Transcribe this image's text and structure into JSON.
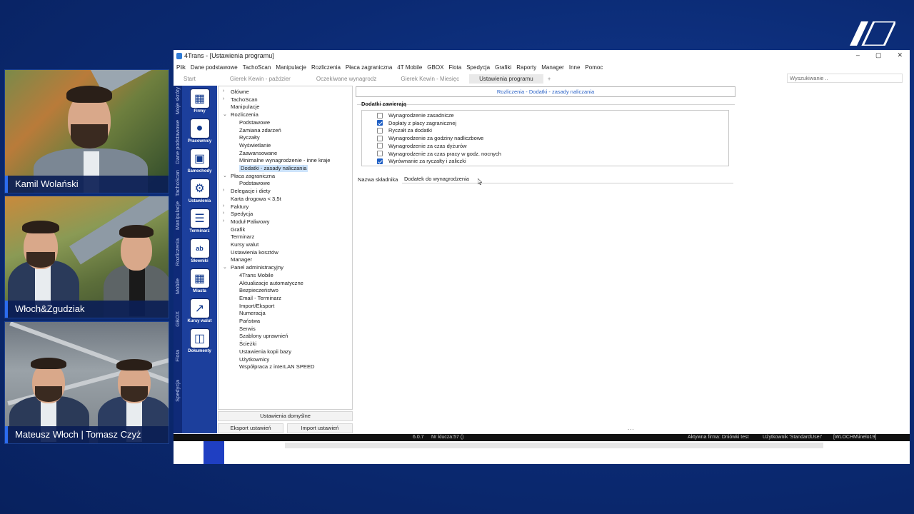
{
  "participants": [
    {
      "name": "Kamil Wolański"
    },
    {
      "name": "Włoch&Zgudziak"
    },
    {
      "name": "Mateusz Włoch | Tomasz Czyż"
    }
  ],
  "app": {
    "title": "4Trans - [Ustawienia programu]",
    "window_controls": [
      "–",
      "▢",
      "✕"
    ],
    "menu": [
      "Plik",
      "Dane podstawowe",
      "TachoScan",
      "Manipulacje",
      "Rozliczenia",
      "Płaca zagraniczna",
      "4T Mobile",
      "GBOX",
      "Flota",
      "Spedycja",
      "Grafiki",
      "Raporty",
      "Manager",
      "Inne",
      "Pomoc"
    ],
    "tabs": [
      "Start",
      "Gierek Kewin - paździer",
      "Oczekiwane wynagrodz",
      "Gierek Kewin - Miesięc",
      "Ustawienia programu"
    ],
    "tab_add": "+",
    "search_placeholder": "Wyszukiwanie ..",
    "vertical_tabs": [
      "Moje skróty",
      "Dane podstawowe",
      "TachoScan",
      "Manipulacje",
      "Rozliczenia",
      "Mobile",
      "GBOX",
      "Flota",
      "Spedycja"
    ],
    "icon_buttons": [
      {
        "label": "Firmy",
        "icon": "building-grid-icon"
      },
      {
        "label": "Pracownicy",
        "icon": "person-icon"
      },
      {
        "label": "Samochody",
        "icon": "truck-icon"
      },
      {
        "label": "Ustawienia",
        "icon": "gear-icon"
      },
      {
        "label": "Terminarz",
        "icon": "calendar-icon"
      },
      {
        "label": "Słowniki",
        "icon": "dictionary-icon"
      },
      {
        "label": "Miasta",
        "icon": "city-icon"
      },
      {
        "label": "Kursy walut",
        "icon": "chart-icon"
      },
      {
        "label": "Dokumenty",
        "icon": "documents-icon"
      }
    ],
    "tree": [
      {
        "label": "Główne",
        "level": 0,
        "arrow": "›"
      },
      {
        "label": "TachoScan",
        "level": 0,
        "arrow": "›"
      },
      {
        "label": "Manipulacje",
        "level": 0,
        "arrow": ""
      },
      {
        "label": "Rozliczenia",
        "level": 0,
        "arrow": "⌄"
      },
      {
        "label": "Podstawowe",
        "level": 1,
        "arrow": ""
      },
      {
        "label": "Zamiana zdarzeń",
        "level": 1,
        "arrow": ""
      },
      {
        "label": "Ryczałty",
        "level": 1,
        "arrow": ""
      },
      {
        "label": "Wyświetlanie",
        "level": 1,
        "arrow": ""
      },
      {
        "label": "Zaawansowane",
        "level": 1,
        "arrow": ""
      },
      {
        "label": "Minimalne wynagrodzenie - inne kraje",
        "level": 1,
        "arrow": ""
      },
      {
        "label": "Dodatki - zasady naliczania",
        "level": 1,
        "arrow": "",
        "selected": true
      },
      {
        "label": "Płaca zagraniczna",
        "level": 0,
        "arrow": "⌄"
      },
      {
        "label": "Podstawowe",
        "level": 1,
        "arrow": ""
      },
      {
        "label": "Delegacje i diety",
        "level": 0,
        "arrow": "›"
      },
      {
        "label": "Karta drogowa < 3,5t",
        "level": 0,
        "arrow": ""
      },
      {
        "label": "Faktury",
        "level": 0,
        "arrow": "›"
      },
      {
        "label": "Spedycja",
        "level": 0,
        "arrow": "›"
      },
      {
        "label": "Moduł Paliwowy",
        "level": 0,
        "arrow": "›"
      },
      {
        "label": "Grafik",
        "level": 0,
        "arrow": ""
      },
      {
        "label": "Terminarz",
        "level": 0,
        "arrow": ""
      },
      {
        "label": "Kursy walut",
        "level": 0,
        "arrow": ""
      },
      {
        "label": "Ustawienia kosztów",
        "level": 0,
        "arrow": ""
      },
      {
        "label": "Manager",
        "level": 0,
        "arrow": ""
      },
      {
        "label": "Panel administracyjny",
        "level": 0,
        "arrow": "⌄"
      },
      {
        "label": "4Trans Mobile",
        "level": 1,
        "arrow": ""
      },
      {
        "label": "Aktualizacje automatyczne",
        "level": 1,
        "arrow": ""
      },
      {
        "label": "Bezpieczeństwo",
        "level": 1,
        "arrow": ""
      },
      {
        "label": "Email - Terminarz",
        "level": 1,
        "arrow": ""
      },
      {
        "label": "Import/Eksport",
        "level": 1,
        "arrow": ""
      },
      {
        "label": "Numeracja",
        "level": 1,
        "arrow": ""
      },
      {
        "label": "Państwa",
        "level": 1,
        "arrow": ""
      },
      {
        "label": "Serwis",
        "level": 1,
        "arrow": ""
      },
      {
        "label": "Szablony uprawnień",
        "level": 1,
        "arrow": ""
      },
      {
        "label": "Ścieżki",
        "level": 1,
        "arrow": ""
      },
      {
        "label": "Ustawienia kopii bazy",
        "level": 1,
        "arrow": ""
      },
      {
        "label": "Użytkownicy",
        "level": 1,
        "arrow": ""
      },
      {
        "label": "Współpraca z interLAN SPEED",
        "level": 1,
        "arrow": ""
      }
    ],
    "buttons": {
      "defaults": "Ustawienia domyślne",
      "export": "Eksport ustawień",
      "import": "Import ustawień"
    },
    "content": {
      "header": "Rozliczenia - Dodatki - zasady naliczania",
      "group_title": "Dodatki zawierają",
      "checkboxes": [
        {
          "label": "Wynagrodzenie zasadnicze",
          "checked": false
        },
        {
          "label": "Dopłaty z płacy zagranicznej",
          "checked": true
        },
        {
          "label": "Ryczałt za dodatki",
          "checked": false
        },
        {
          "label": "Wynagrodzenie za godziny nadliczbowe",
          "checked": false
        },
        {
          "label": "Wynagrodzenie za czas dyżurów",
          "checked": false
        },
        {
          "label": "Wynagrodzenie za czas pracy w godz. nocnych",
          "checked": false
        },
        {
          "label": "Wyrównanie za ryczałty i zaliczki",
          "checked": true
        }
      ],
      "field_label": "Nazwa składnika",
      "field_value": "Dodatek do wynagrodzenia",
      "dots": "..."
    },
    "status": {
      "version": "6.0.7",
      "key": "Nr klucza:57 ()",
      "firm": "Aktywna firma: Dniówki test",
      "user": "Użytkownik 'StandardUser'",
      "machine": "[WLOCHM\\inelo19]"
    }
  },
  "colors": {
    "background": "#0b2a73",
    "accent": "#1c3f9c",
    "selection": "#cde3fb",
    "link": "#2a62c6"
  }
}
